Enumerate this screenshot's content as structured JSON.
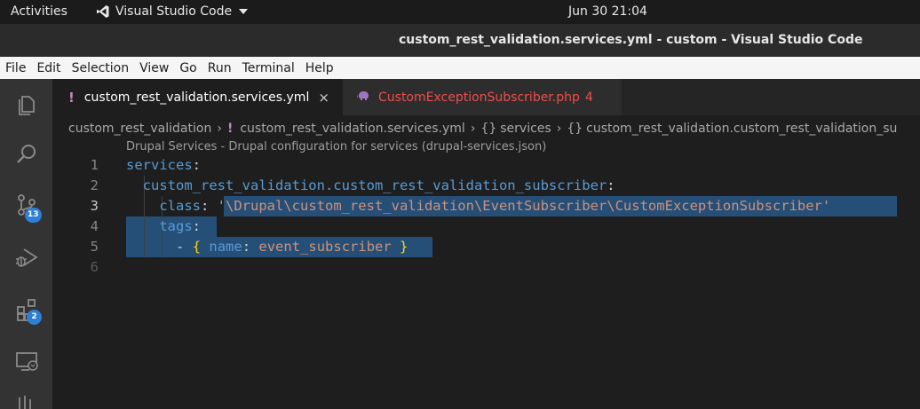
{
  "topbar": {
    "activities": "Activities",
    "app_name": "Visual Studio Code",
    "clock": "Jun 30  21:04"
  },
  "window": {
    "title": "custom_rest_validation.services.yml - custom - Visual Studio Code"
  },
  "menu": [
    "File",
    "Edit",
    "Selection",
    "View",
    "Go",
    "Run",
    "Terminal",
    "Help"
  ],
  "activity_bar": {
    "items": [
      {
        "name": "explorer-icon"
      },
      {
        "name": "search-icon"
      },
      {
        "name": "source-control-icon",
        "badge": "13"
      },
      {
        "name": "run-debug-icon"
      },
      {
        "name": "extensions-icon",
        "badge": "2"
      },
      {
        "name": "remote-explorer-icon"
      }
    ]
  },
  "tabs": [
    {
      "label": "custom_rest_validation.services.yml",
      "modified_marker": "!",
      "close": "×",
      "active": true
    },
    {
      "label": "CustomExceptionSubscriber.php",
      "errors": "4",
      "active": false
    }
  ],
  "breadcrumb": {
    "folder": "custom_rest_validation",
    "file": "custom_rest_validation.services.yml",
    "sym1": "services",
    "sym2": "custom_rest_validation.custom_rest_validation_su"
  },
  "schema_hint": "Drupal Services - Drupal configuration for services (drupal-services.json)",
  "editor": {
    "current_line": 3,
    "line_numbers": [
      "1",
      "2",
      "3",
      "4",
      "5",
      "6"
    ],
    "lines": {
      "l1_key": "services",
      "l2_key": "custom_rest_validation.custom_rest_validation_subscriber",
      "l3_key": "class",
      "l3_value": "'\\Drupal\\custom_rest_validation\\EventSubscriber\\CustomExceptionSubscriber'",
      "l4_key": "tags",
      "l5_dash": "-",
      "l5_open": "{",
      "l5_key": "name",
      "l5_value": "event_subscriber",
      "l5_close": "}"
    }
  },
  "colors": {
    "accent_badge": "#2f7fd6",
    "selection": "#264f78",
    "yaml_key": "#569cd6",
    "yaml_string": "#ce9178",
    "error_tab": "#f14c4c"
  }
}
